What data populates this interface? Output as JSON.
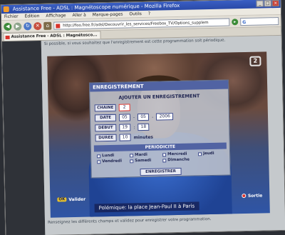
{
  "window": {
    "title": "Assistance Free - ADSL : Magnétoscope numérique - Mozilla Firefox",
    "controls": [
      "_",
      "□",
      "×"
    ]
  },
  "menu": [
    "Fichier",
    "Édition",
    "Affichage",
    "Aller à",
    "Marque-pages",
    "Outils",
    "?"
  ],
  "nav": {
    "url": "http://foo.free.fr/adsl/Decouvrir_les_services/Freebox_TV/Options_supplem",
    "go_label": "OK",
    "search_placeholder": ""
  },
  "tabs": [
    {
      "label": "Assistance Free - ADSL : Magnétosco..."
    }
  ],
  "page": {
    "intro": "Si possible, si vous souhaitez que l'enregistrement est cette programmation soit périodique.",
    "outro": "Renseignez les différents champs et validez pour enregistrer votre programmation."
  },
  "tv": {
    "logo": "2",
    "headline": "Polémique: la place Jean-Paul II à Paris",
    "ok_label": "OK",
    "validate_label": "Valider",
    "exit_label": "Sortie"
  },
  "dialog": {
    "title": "ENREGISTREMENT",
    "subtitle": "AJOUTER UN ENREGISTREMENT",
    "channel_label": "CHAINE",
    "channel_value": "2",
    "date_label": "DATE",
    "date_day": "05",
    "date_month": "05",
    "date_year": "2006",
    "start_label": "DEBUT",
    "start_hour": "19",
    "start_min": "18",
    "duration_label": "DUREE",
    "duration_value": "10",
    "duration_unit": "minutes",
    "period_label": "PERIODICITE",
    "days": [
      "Lundi",
      "Mardi",
      "Mercredi",
      "Jeudi",
      "Vendredi",
      "Samedi",
      "Dimanche"
    ],
    "save_label": "ENREGISTRER"
  }
}
